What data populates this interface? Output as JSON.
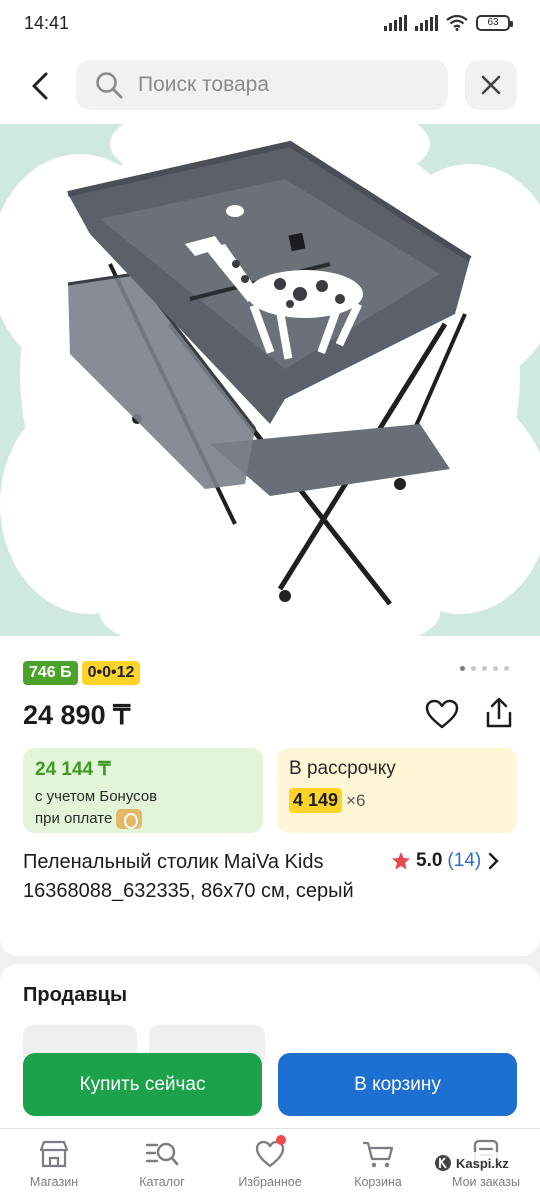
{
  "status": {
    "time": "14:41",
    "battery": "63"
  },
  "search": {
    "placeholder": "Поиск товара"
  },
  "product": {
    "bonus_badge": "746 Б",
    "installment_badge": "0•0•12",
    "price": "24 890 ₸",
    "bonus_price": "24 144 ₸",
    "bonus_note_line1": "с учетом Бонусов",
    "bonus_note_line2": "при оплате",
    "installment_title": "В рассрочку",
    "installment_amount": "4 149",
    "installment_months": "×6",
    "title": "Пеленальный столик MaiVa Kids 16368088_632335, 86х70 см, серый",
    "rating": "5.0",
    "reviews": "(14)"
  },
  "sellers": {
    "title": "Продавцы"
  },
  "actions": {
    "buy_now": "Купить сейчас",
    "to_cart": "В корзину"
  },
  "tabs": [
    {
      "label": "Магазин",
      "icon": "store-icon"
    },
    {
      "label": "Каталог",
      "icon": "catalog-search-icon"
    },
    {
      "label": "Избранное",
      "icon": "heart-icon"
    },
    {
      "label": "Корзина",
      "icon": "cart-icon"
    },
    {
      "label": "Мои заказы",
      "icon": "orders-icon"
    }
  ],
  "watermark": "Kaspi.kz",
  "colors": {
    "bonus_green": "#4ca32b",
    "installment_yellow": "#fed42b",
    "buy_green": "#1ba24a",
    "cart_blue": "#1d6fd1",
    "rating_star": "#e5484d"
  }
}
